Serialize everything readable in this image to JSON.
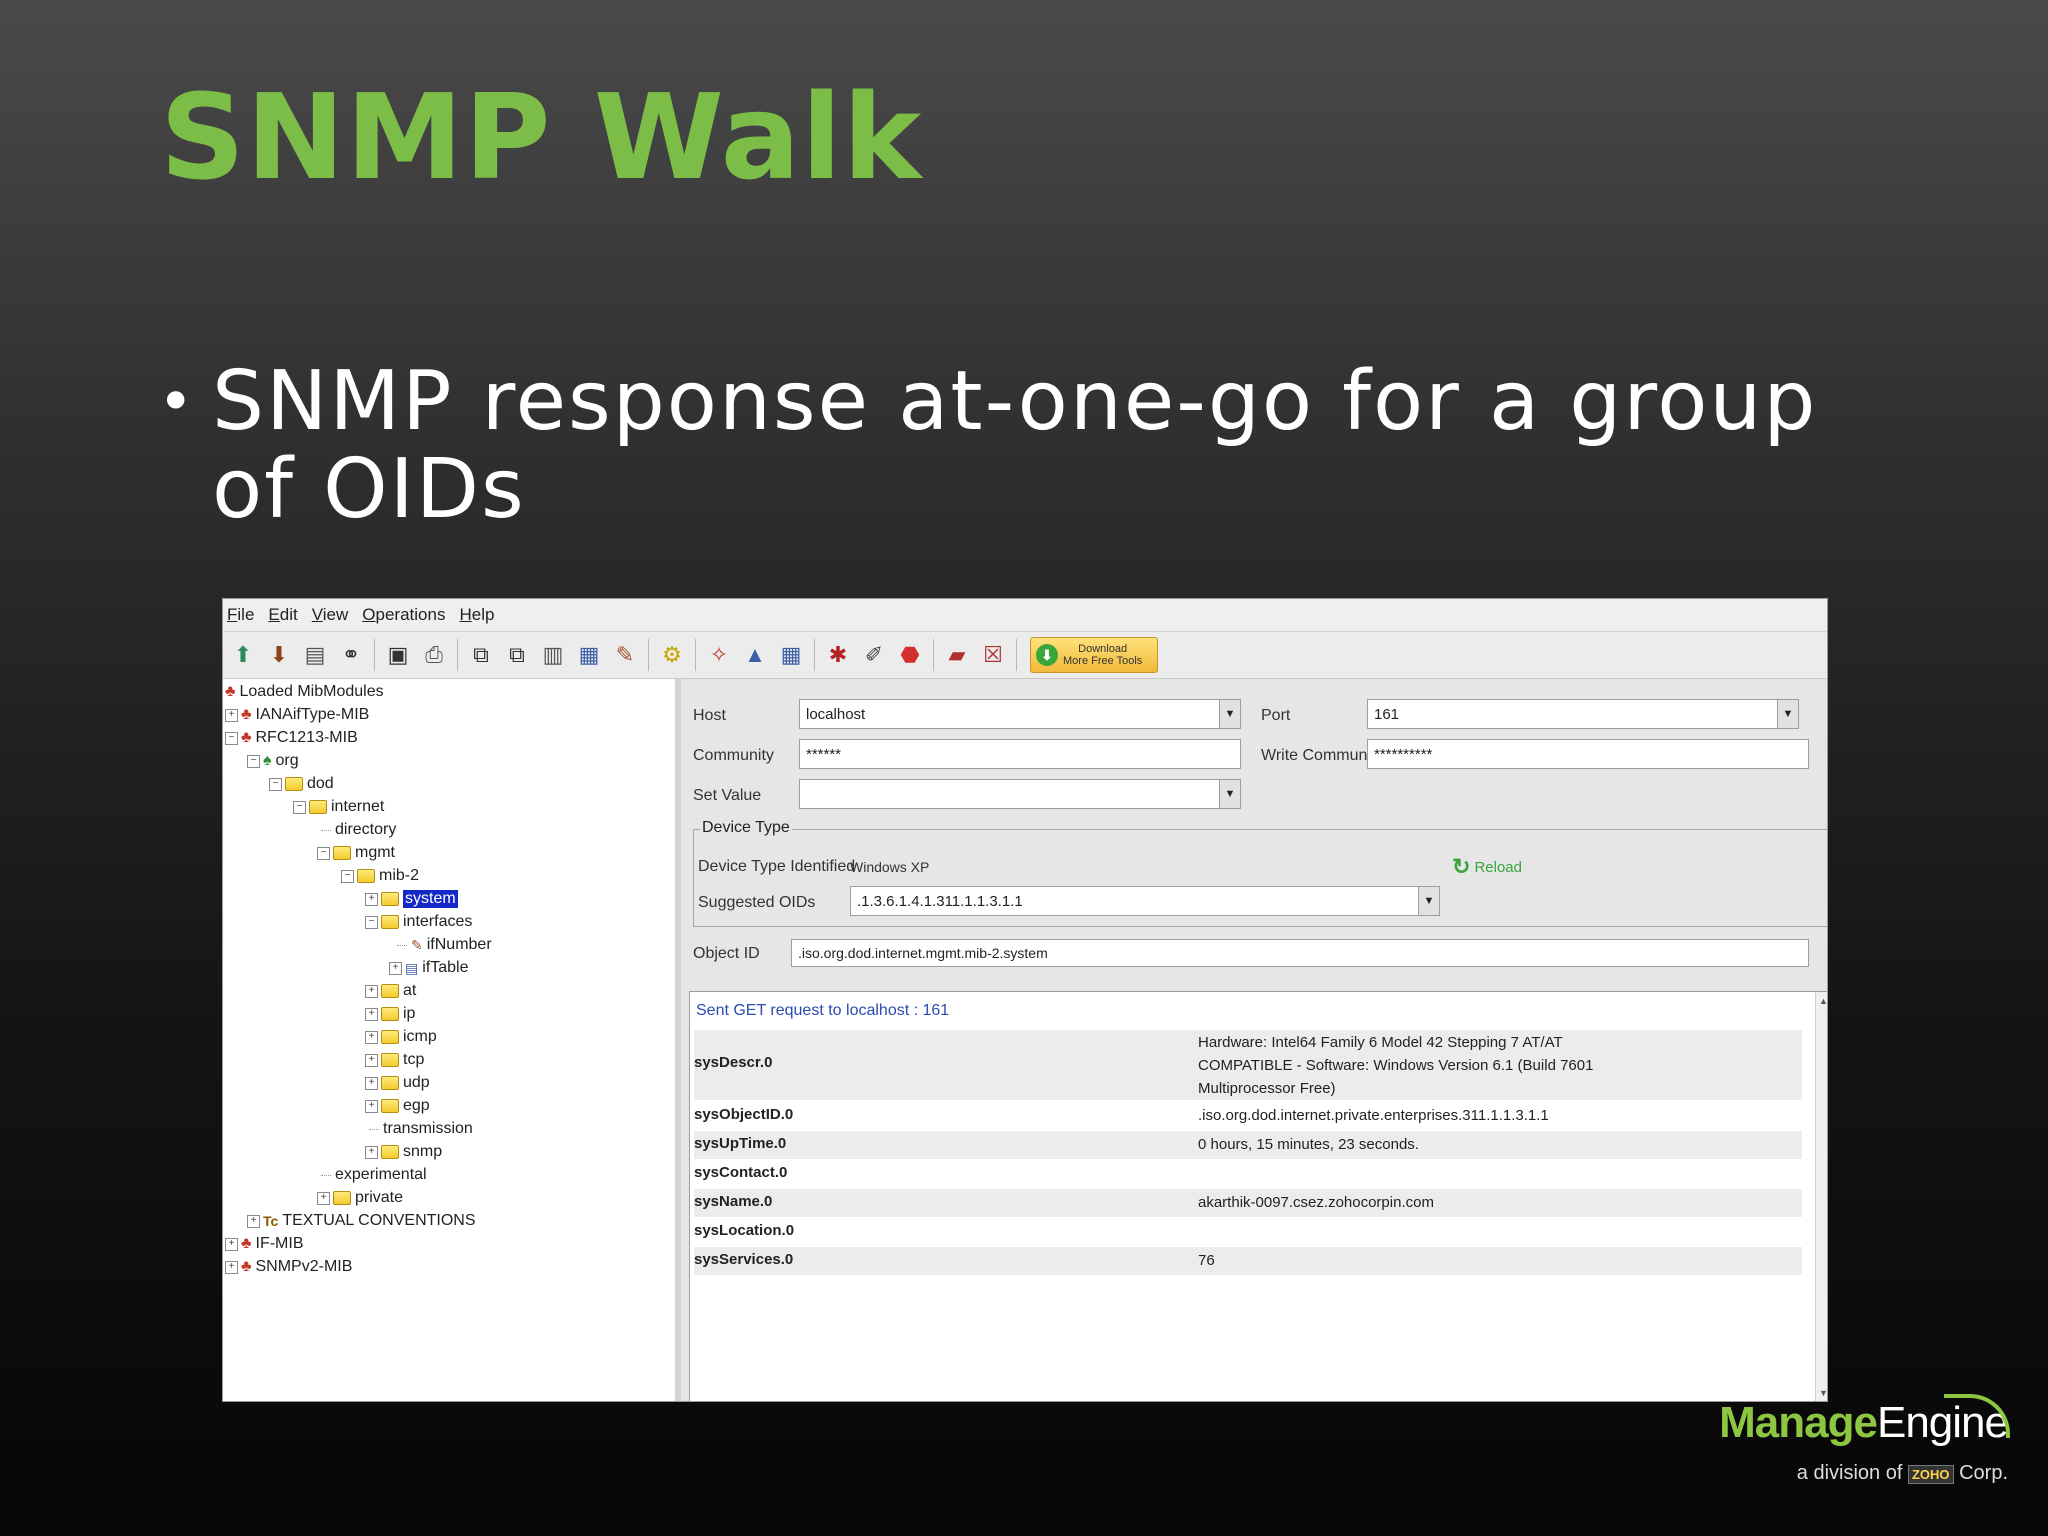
{
  "slide": {
    "title": "SNMP Walk",
    "bullet": "SNMP response at-one-go for a group of OIDs"
  },
  "app": {
    "menu": [
      "File",
      "Edit",
      "View",
      "Operations",
      "Help"
    ],
    "download_button": {
      "line1": "Download",
      "line2": "More Free Tools"
    },
    "tree": {
      "root": "Loaded MibModules",
      "items": [
        "IANAifType-MIB",
        "RFC1213-MIB",
        "org",
        "dod",
        "internet",
        "directory",
        "mgmt",
        "mib-2",
        "system",
        "interfaces",
        "ifNumber",
        "ifTable",
        "at",
        "ip",
        "icmp",
        "tcp",
        "udp",
        "egp",
        "transmission",
        "snmp",
        "experimental",
        "private",
        "TEXTUAL CONVENTIONS",
        "IF-MIB",
        "SNMPv2-MIB"
      ]
    },
    "form": {
      "host_label": "Host",
      "host_value": "localhost",
      "port_label": "Port",
      "port_value": "161",
      "community_label": "Community",
      "community_value": "******",
      "write_community_label": "Write Community",
      "write_community_value": "**********",
      "set_value_label": "Set Value",
      "set_value_value": "",
      "device_type_legend": "Device Type",
      "device_type_identified_label": "Device Type Identified",
      "device_type_identified_value": "Windows XP",
      "reload_label": "Reload",
      "suggested_oids_label": "Suggested OIDs",
      "suggested_oids_value": ".1.3.6.1.4.1.311.1.1.3.1.1",
      "object_id_label": "Object ID",
      "object_id_value": ".iso.org.dod.internet.mgmt.mib-2.system"
    },
    "results": {
      "header": "Sent GET request to localhost : 161",
      "rows": [
        {
          "key": "sysDescr.0",
          "value": "Hardware: Intel64 Family 6 Model 42 Stepping 7 AT/AT COMPATIBLE - Software: Windows Version 6.1 (Build 7601 Multiprocessor Free)"
        },
        {
          "key": "sysObjectID.0",
          "value": ".iso.org.dod.internet.private.enterprises.311.1.1.3.1.1"
        },
        {
          "key": "sysUpTime.0",
          "value": "0 hours, 15 minutes, 23 seconds."
        },
        {
          "key": "sysContact.0",
          "value": ""
        },
        {
          "key": "sysName.0",
          "value": "akarthik-0097.csez.zohocorpin.com"
        },
        {
          "key": "sysLocation.0",
          "value": ""
        },
        {
          "key": "sysServices.0",
          "value": "76"
        }
      ]
    }
  },
  "brand": {
    "manage": "Manage",
    "engine": "Engine",
    "sub_prefix": "a division of",
    "zoho": "ZOHO",
    "sub_suffix": "Corp."
  },
  "colors": {
    "title_green": "#7cbd47",
    "brand_green": "#8dc641",
    "selection_blue": "#1428c8",
    "result_header_blue": "#2a4bb0"
  }
}
